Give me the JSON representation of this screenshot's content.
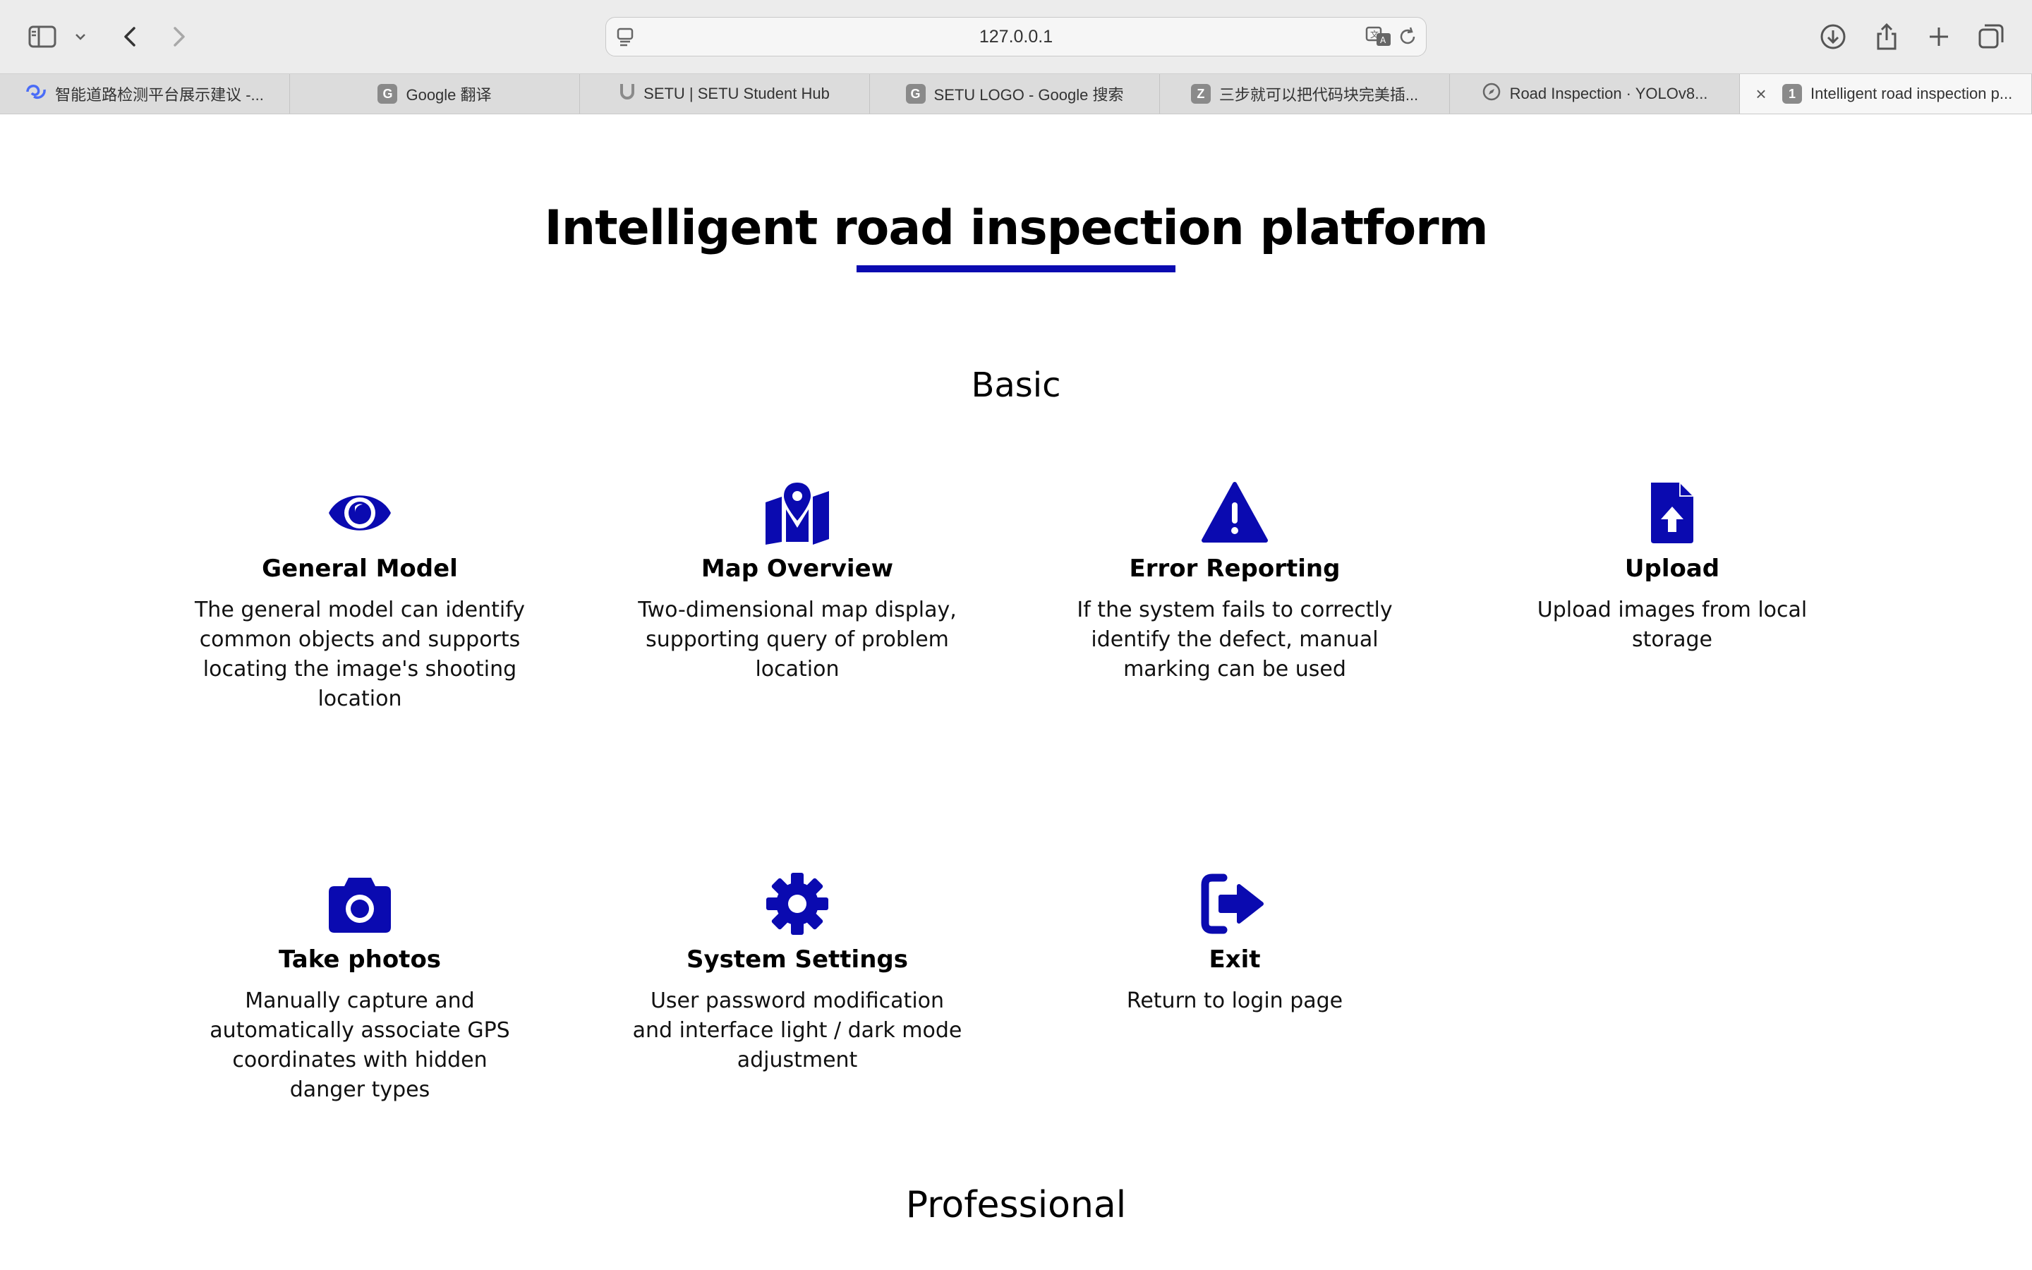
{
  "browser": {
    "url": "127.0.0.1",
    "tabs": [
      {
        "label": "智能道路检测平台展示建议 -...",
        "favicon": "swirl-icon",
        "favicon_text": ""
      },
      {
        "label": "Google 翻译",
        "favicon": "google-icon",
        "favicon_text": "G"
      },
      {
        "label": "SETU | SETU Student Hub",
        "favicon": "setu-icon",
        "favicon_text": ""
      },
      {
        "label": "SETU LOGO - Google 搜索",
        "favicon": "google-icon",
        "favicon_text": "G"
      },
      {
        "label": "三步就可以把代码块完美插...",
        "favicon": "zhihu-icon",
        "favicon_text": "Z"
      },
      {
        "label": "Road Inspection · YOLOv8...",
        "favicon": "compass-icon",
        "favicon_text": ""
      },
      {
        "label": "Intelligent road inspection p...",
        "favicon": "number-icon",
        "favicon_text": "1",
        "active": true
      }
    ]
  },
  "page": {
    "title": "Intelligent road inspection platform",
    "accent_color": "#0a0ab0",
    "sections": {
      "basic": "Basic",
      "professional": "Professional"
    },
    "features": [
      {
        "icon": "eye-icon",
        "name": "General Model",
        "desc": "The general model can identify common objects and supports locating the image's shooting location"
      },
      {
        "icon": "map-pin-icon",
        "name": "Map Overview",
        "desc": "Two-dimensional map display, supporting query of problem location"
      },
      {
        "icon": "warning-icon",
        "name": "Error Reporting",
        "desc": "If the system fails to correctly identify the defect, manual marking can be used"
      },
      {
        "icon": "file-upload-icon",
        "name": "Upload",
        "desc": "Upload images from local storage"
      },
      {
        "icon": "camera-icon",
        "name": "Take photos",
        "desc": "Manually capture and automatically associate GPS coordinates with hidden danger types"
      },
      {
        "icon": "gear-icon",
        "name": "System Settings",
        "desc": "User password modification and interface light / dark mode adjustment"
      },
      {
        "icon": "exit-icon",
        "name": "Exit",
        "desc": "Return to login page"
      }
    ]
  }
}
